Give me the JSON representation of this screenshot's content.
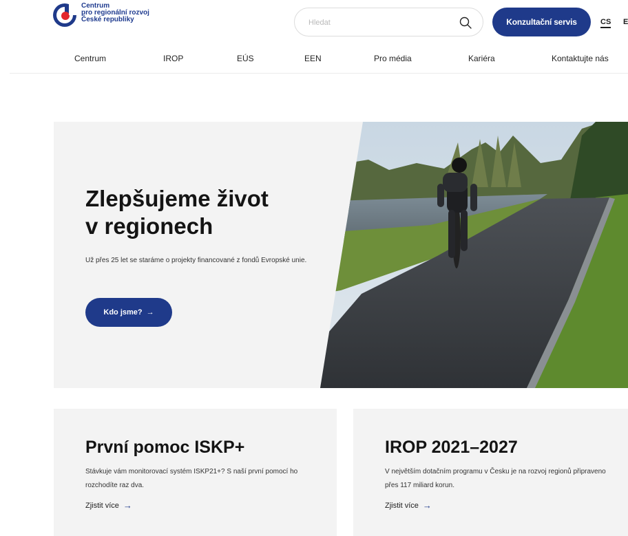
{
  "logo": {
    "line1": "Centrum",
    "line2": "pro regionální rozvoj",
    "line3": "České republiky"
  },
  "search": {
    "placeholder": "Hledat"
  },
  "header": {
    "consult_label": "Konzultační servis",
    "lang_cs": "CS",
    "lang_en": "E"
  },
  "nav": {
    "items": [
      {
        "label": "Centrum"
      },
      {
        "label": "IROP"
      },
      {
        "label": "EÚS"
      },
      {
        "label": "EEN"
      },
      {
        "label": "Pro média"
      },
      {
        "label": "Kariéra"
      },
      {
        "label": "Kontaktujte nás"
      }
    ]
  },
  "hero": {
    "title_line1": "Zlepšujeme život",
    "title_line2": "v regionech",
    "text": "Už přes 25 let se staráme o projekty financované z fondů Evropské unie.",
    "button_label": "Kdo jsme?",
    "button_arrow": "→"
  },
  "cards": [
    {
      "title": "První pomoc ISKP+",
      "text": "Stávkuje vám monitorovací systém ISKP21+? S naší první pomocí ho rozchodíte raz dva.",
      "link": "Zjistit více",
      "arrow": "→"
    },
    {
      "title": "IROP 2021–2027",
      "text": "V největším dotačním programu v Česku je na rozvoj regionů připraveno přes 117 miliard korun.",
      "link": "Zjistit více",
      "arrow": "→"
    }
  ],
  "colors": {
    "brand_blue": "#1f3a8a",
    "logo_red": "#e3262e",
    "panel_bg": "#f3f3f3"
  }
}
